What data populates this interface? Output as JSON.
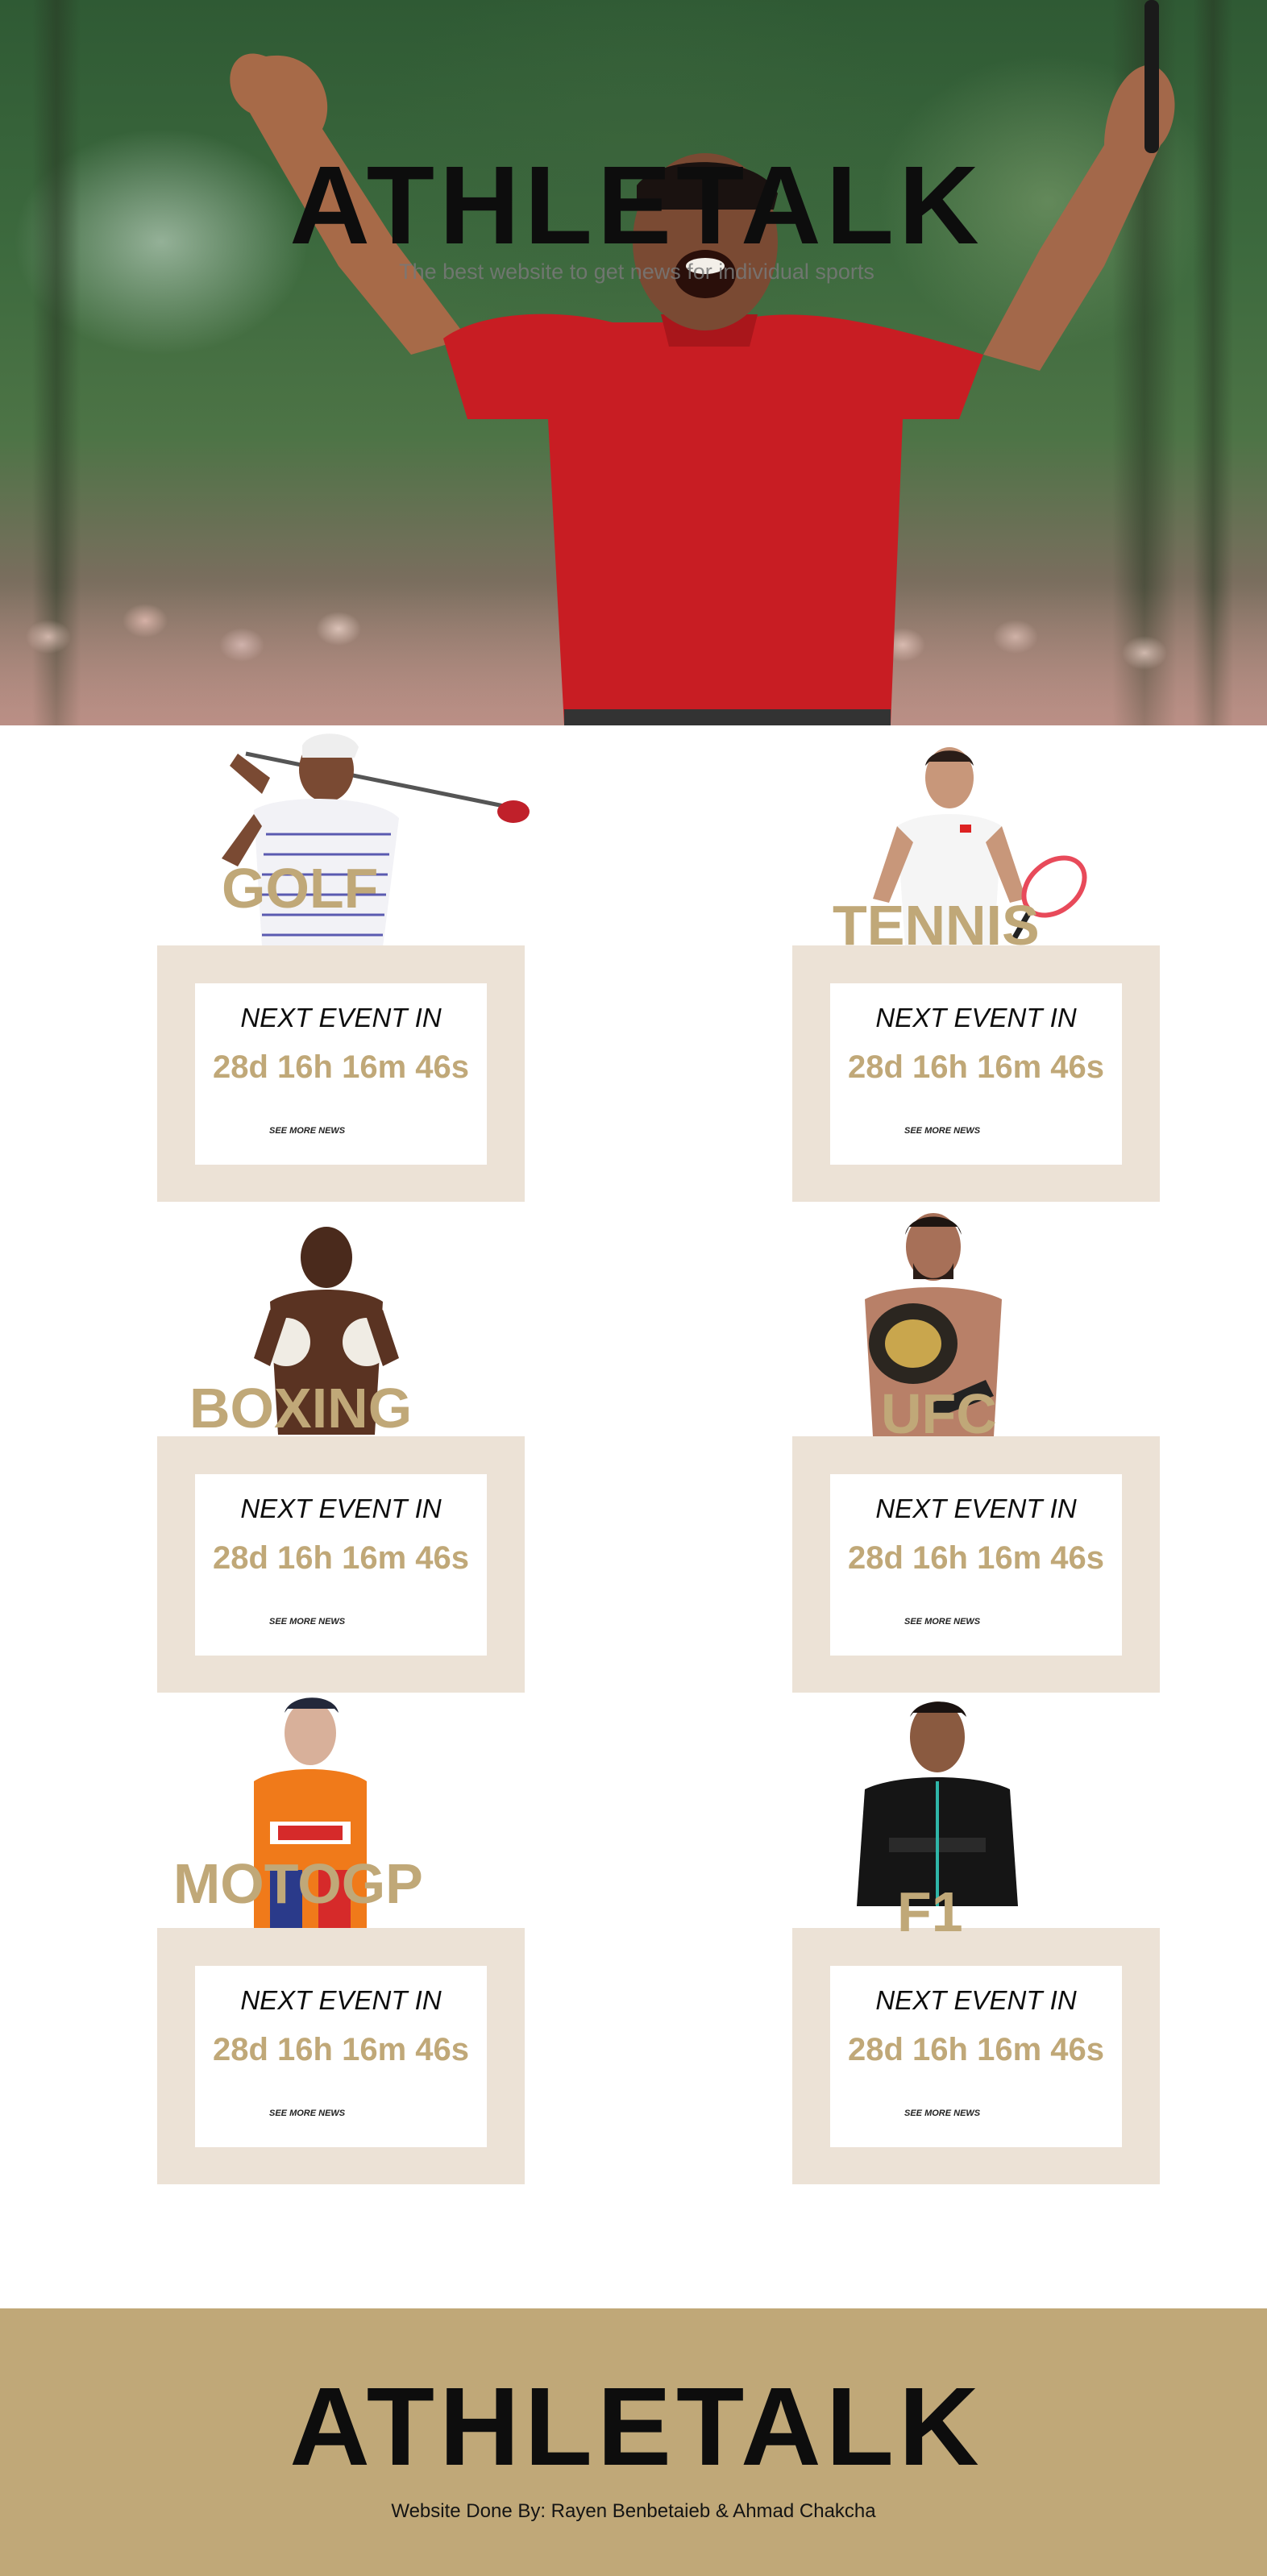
{
  "hero": {
    "logo": "ATHLETALK",
    "tagline": "The best website to get news for individual sports"
  },
  "sports": [
    {
      "name": "GOLF",
      "label": "NEXT EVENT IN",
      "timer": "28d 16h 16m 46s",
      "link": "SEE MORE NEWS",
      "icon": "golfer-photo"
    },
    {
      "name": "TENNIS",
      "label": "NEXT EVENT IN",
      "timer": "28d 16h 16m 46s",
      "link": "SEE MORE NEWS",
      "icon": "tennis-player-photo"
    },
    {
      "name": "BOXING",
      "label": "NEXT EVENT IN",
      "timer": "28d 16h 16m 46s",
      "link": "SEE MORE NEWS",
      "icon": "boxer-photo"
    },
    {
      "name": "UFC",
      "label": "NEXT EVENT IN",
      "timer": "28d 16h 16m 46s",
      "link": "SEE MORE NEWS",
      "icon": "ufc-fighter-photo"
    },
    {
      "name": "MOTOGP",
      "label": "NEXT EVENT IN",
      "timer": "28d 16h 16m 46s",
      "link": "SEE MORE NEWS",
      "icon": "motogp-rider-photo"
    },
    {
      "name": "F1",
      "label": "NEXT EVENT IN",
      "timer": "28d 16h 16m 46s",
      "link": "SEE MORE NEWS",
      "icon": "f1-driver-photo"
    }
  ],
  "footer": {
    "logo": "ATHLETALK",
    "credit": "Website Done By: Rayen Benbetaieb & Ahmad Chakcha"
  },
  "colors": {
    "accent": "#c0a878",
    "card_bg": "#ece2d6",
    "text": "#0d0d0d"
  }
}
